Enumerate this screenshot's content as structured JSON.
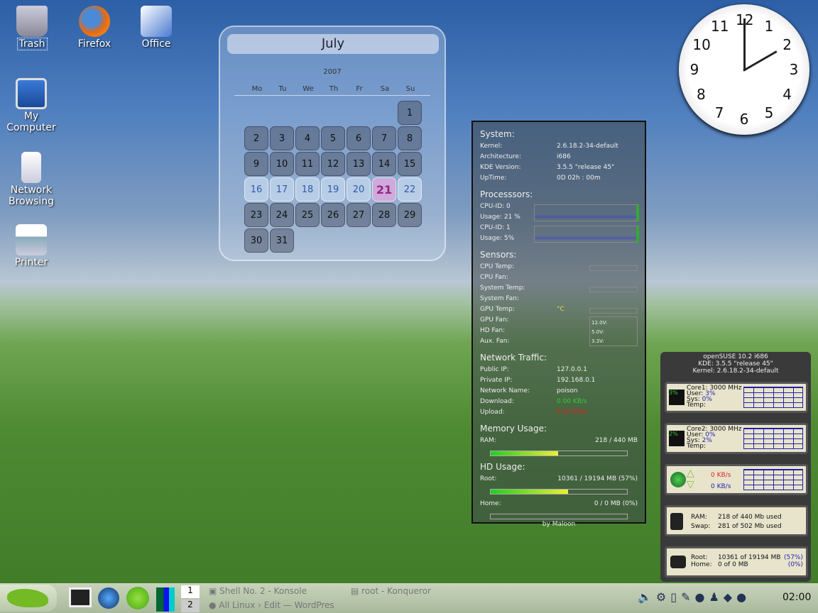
{
  "desktop_icons": [
    {
      "label": "Trash",
      "icon": "trash-icon"
    },
    {
      "label": "Firefox",
      "icon": "firefox-icon"
    },
    {
      "label": "Office",
      "icon": "office-icon"
    },
    {
      "label": "My Computer",
      "icon": "computer-icon"
    },
    {
      "label": "Network Browsing",
      "icon": "network-icon"
    },
    {
      "label": "Printer",
      "icon": "printer-icon"
    }
  ],
  "calendar": {
    "month": "July",
    "year": "2007",
    "weekdays": [
      "Mo",
      "Tu",
      "We",
      "Th",
      "Fr",
      "Sa",
      "Su"
    ],
    "today": 21,
    "highlight_week": [
      16,
      22
    ]
  },
  "clock": {
    "numbers": [
      "12",
      "1",
      "2",
      "3",
      "4",
      "5",
      "6",
      "7",
      "8",
      "9",
      "10",
      "11"
    ],
    "time": "02:00"
  },
  "system": {
    "title": "System:",
    "rows": [
      [
        "Kernel:",
        "2.6.18.2-34-default"
      ],
      [
        "Architecture:",
        "i686"
      ],
      [
        "KDE Version:",
        "3.5.5 \"release 45\""
      ],
      [
        "UpTime:",
        "0D   02h : 00m"
      ]
    ],
    "proc_title": "Processsors:",
    "proc": [
      [
        "CPU-ID: 0",
        "Usage:  21 %"
      ],
      [
        "CPU-ID: 1",
        "Usage:  5%"
      ]
    ],
    "sensors_title": "Sensors:",
    "sensors": [
      "CPU Temp:",
      "CPU Fan:",
      "System Temp:",
      "System Fan:",
      "GPU Temp:",
      "GPU Fan:",
      "HD Fan:",
      "Aux. Fan:"
    ],
    "gpu_temp_unit": "°C",
    "volts": [
      "12.0V:",
      "5.0V:",
      "3.3V:"
    ],
    "net_title": "Network Traffic:",
    "net": [
      [
        "Public IP:",
        "127.0.0.1"
      ],
      [
        "Private IP:",
        "192.168.0.1"
      ],
      [
        "Network Name:",
        "poison"
      ],
      [
        "Download:",
        "0.00 KB/s"
      ],
      [
        "Upload:",
        "0.00 KB/s"
      ]
    ],
    "mem_title": "Memory Usage:",
    "ram_label": "RAM:",
    "ram_value": "218  /  440 MB",
    "ram_fraction": 0.495,
    "hd_title": "HD Usage:",
    "root_label": "Root:",
    "root_value": "10361 / 19194 MB  (57%)",
    "root_fraction": 0.57,
    "home_label": "Home:",
    "home_value": "0 / 0 MB  (0%)",
    "home_fraction": 0,
    "credit": "by Maloon"
  },
  "kp": {
    "header": [
      "openSUSE 10.2 i686",
      "KDE: 3.5.5 \"release 45\"",
      "Kernel: 2.6.18.2-34-default"
    ],
    "core1": {
      "badge": "3%",
      "name": "Core1: 3000 MHz",
      "user": "3%",
      "sys": "0%"
    },
    "core2": {
      "badge": "2%",
      "name": "Core2: 3000 MHz",
      "user": "0%",
      "sys": "2%"
    },
    "labels": {
      "user": "User:",
      "sys": "Sys:",
      "temp": "Temp:"
    },
    "net": {
      "up": "0 KB/s",
      "down": "0 KB/s"
    },
    "mem": {
      "ram_label": "RAM:",
      "ram": "218 of 440 Mb used",
      "swap_label": "Swap:",
      "swap": "281 of 502 Mb used"
    },
    "disk": {
      "root_label": "Root:",
      "root": "10361 of 19194 MB",
      "root_pct": "(57%)",
      "home_label": "Home:",
      "home": "0 of 0 MB",
      "home_pct": "(0%)"
    }
  },
  "taskbar": {
    "desktops": [
      "1",
      "2"
    ],
    "tasks": [
      "Shell No. 2 - Konsole",
      "root - Konqueror",
      "All Linux › Edit — WordPres"
    ],
    "clock": "02:00",
    "colors": {
      "accent": "#73ba25"
    }
  }
}
